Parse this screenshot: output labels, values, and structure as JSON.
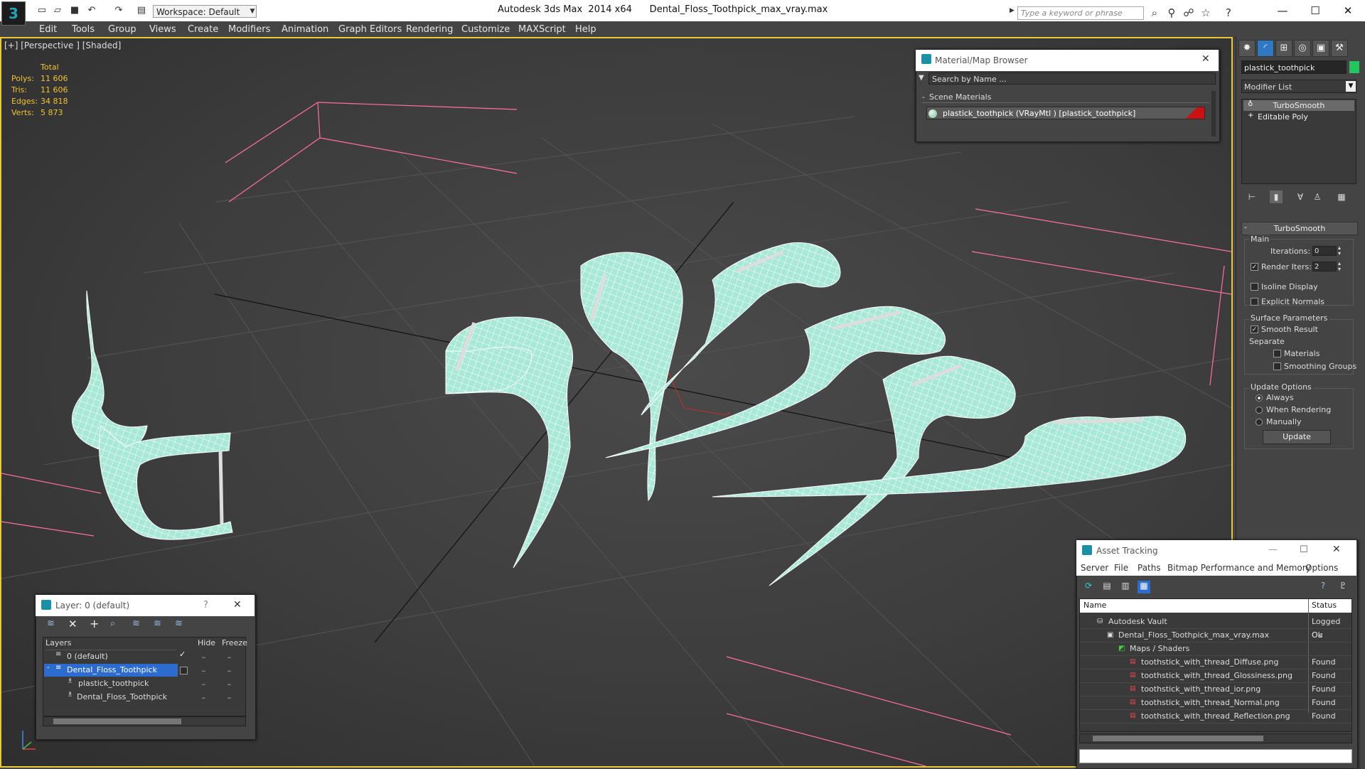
{
  "app": {
    "title": "Autodesk 3ds Max  2014 x64      Dental_Floss_Toothpick_max_vray.max",
    "logo": "3",
    "workspace": "Workspace: Default",
    "search_placeholder": "Type a keyword or phrase",
    "win_minimize": "—",
    "win_maximize": "☐",
    "win_close": "✕"
  },
  "menu": [
    "Edit",
    "Tools",
    "Group",
    "Views",
    "Create",
    "Modifiers",
    "Animation",
    "Graph Editors",
    "Rendering",
    "Customize",
    "MAXScript",
    "Help"
  ],
  "viewport": {
    "label": "[+] [Perspective ] [Shaded]",
    "stats": {
      "header": "Total",
      "rows": [
        {
          "label": "Polys:",
          "value": "11 606"
        },
        {
          "label": "Tris:",
          "value": "11 606"
        },
        {
          "label": "Edges:",
          "value": "34 818"
        },
        {
          "label": "Verts:",
          "value": "5 873"
        }
      ]
    },
    "gizmo_x": "x",
    "gizmo_y": "y",
    "colors": {
      "mesh": "#a8e8d6",
      "wire": "#ffffff",
      "bounds": "#ff6f9f",
      "border": "#e8c93e"
    }
  },
  "command_panel": {
    "object_name": "plastick_toothpick",
    "object_color": "#22c55e",
    "modifier_list": "Modifier List",
    "stack": [
      {
        "label": "TurboSmooth",
        "active": true
      },
      {
        "label": "Editable Poly",
        "active": false
      }
    ],
    "turbosmooth": {
      "header": "TurboSmooth",
      "main_label": "Main",
      "iterations_label": "Iterations:",
      "iterations_value": "0",
      "render_iters_label": "Render Iters:",
      "render_iters_value": "2",
      "render_iters_checked": true,
      "isoline_label": "Isoline Display",
      "explicit_label": "Explicit Normals",
      "surface_label": "Surface Parameters",
      "smooth_label": "Smooth Result",
      "separate_label": "Separate",
      "materials_label": "Materials",
      "smoothing_label": "Smoothing Groups",
      "update_label": "Update Options",
      "always_label": "Always",
      "when_rendering_label": "When Rendering",
      "manually_label": "Manually",
      "update_button": "Update"
    }
  },
  "material_browser": {
    "title": "Material/Map Browser",
    "search_placeholder": "Search by Name ...",
    "section": "Scene Materials",
    "item": "plastick_toothpick (VRayMtl ) [plastick_toothpick]",
    "close": "✕"
  },
  "layer_dialog": {
    "title": "Layer: 0 (default)",
    "help": "?",
    "close": "✕",
    "columns": {
      "layers": "Layers",
      "hide": "Hide",
      "freeze": "Freeze"
    },
    "rows": [
      {
        "label": "0 (default)",
        "selected": false
      },
      {
        "label": "Dental_Floss_Toothpick",
        "selected": true
      },
      {
        "label": "plastick_toothpick",
        "selected": false
      },
      {
        "label": "Dental_Floss_Toothpick",
        "selected": false
      }
    ]
  },
  "asset_tracking": {
    "title": "Asset Tracking",
    "minimize": "—",
    "maximize": "☐",
    "close": "✕",
    "menu": [
      "Server",
      "File",
      "Paths",
      "Bitmap Performance and Memory",
      "Options"
    ],
    "columns": {
      "name": "Name",
      "status": "Status"
    },
    "rows": [
      {
        "name": "Autodesk Vault",
        "status": "Logged Ou"
      },
      {
        "name": "Dental_Floss_Toothpick_max_vray.max",
        "status": "Ok"
      },
      {
        "name": "Maps / Shaders",
        "status": ""
      },
      {
        "name": "toothstick_with_thread_Diffuse.png",
        "status": "Found"
      },
      {
        "name": "toothstick_with_thread_Glossiness.png",
        "status": "Found"
      },
      {
        "name": "toothstick_with_thread_ior.png",
        "status": "Found"
      },
      {
        "name": "toothstick_with_thread_Normal.png",
        "status": "Found"
      },
      {
        "name": "toothstick_with_thread_Reflection.png",
        "status": "Found"
      }
    ]
  }
}
